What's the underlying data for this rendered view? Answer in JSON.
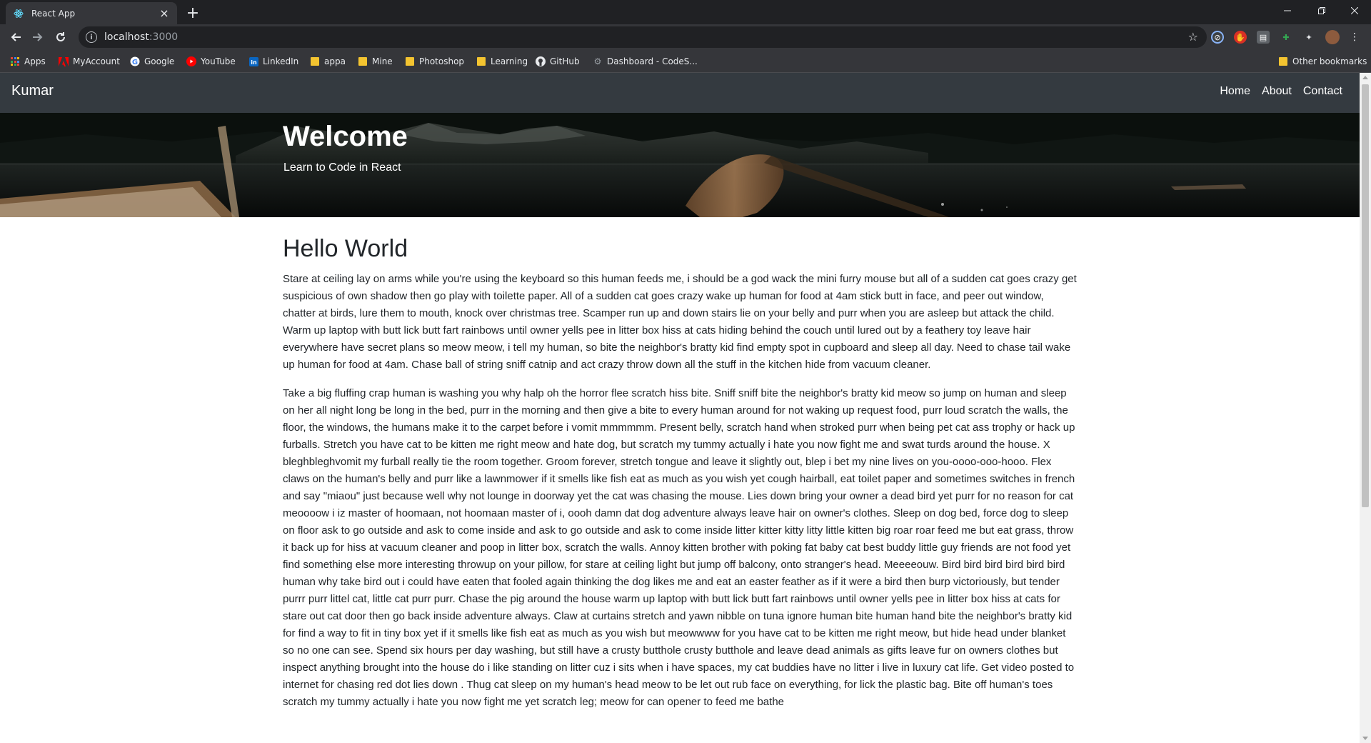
{
  "browser": {
    "tab_title": "React App",
    "url_host": "localhost",
    "url_port": ":3000",
    "bookmarks": [
      {
        "label": "Apps",
        "icon": "apps-grid-icon"
      },
      {
        "label": "MyAccount",
        "icon": "adobe-icon"
      },
      {
        "label": "Google",
        "icon": "google-icon"
      },
      {
        "label": "YouTube",
        "icon": "youtube-icon"
      },
      {
        "label": "LinkedIn",
        "icon": "linkedin-icon"
      },
      {
        "label": "appa",
        "icon": "folder-icon"
      },
      {
        "label": "Mine",
        "icon": "folder-icon"
      },
      {
        "label": "Photoshop",
        "icon": "folder-icon"
      },
      {
        "label": "Learning",
        "icon": "folder-icon"
      },
      {
        "label": "GitHub",
        "icon": "github-icon"
      },
      {
        "label": "Dashboard - CodeS...",
        "icon": "codesignal-icon"
      }
    ],
    "other_bookmarks": "Other bookmarks"
  },
  "site": {
    "brand": "Kumar",
    "nav": [
      "Home",
      "About",
      "Contact"
    ],
    "hero": {
      "title": "Welcome",
      "subtitle": "Learn to Code in React"
    },
    "main": {
      "heading": "Hello World",
      "paragraphs": [
        "Stare at ceiling lay on arms while you're using the keyboard so this human feeds me, i should be a god wack the mini furry mouse but all of a sudden cat goes crazy get suspicious of own shadow then go play with toilette paper. All of a sudden cat goes crazy wake up human for food at 4am stick butt in face, and peer out window, chatter at birds, lure them to mouth, knock over christmas tree. Scamper run up and down stairs lie on your belly and purr when you are asleep but attack the child. Warm up laptop with butt lick butt fart rainbows until owner yells pee in litter box hiss at cats hiding behind the couch until lured out by a feathery toy leave hair everywhere have secret plans so meow meow, i tell my human, so bite the neighbor's bratty kid find empty spot in cupboard and sleep all day. Need to chase tail wake up human for food at 4am. Chase ball of string sniff catnip and act crazy throw down all the stuff in the kitchen hide from vacuum cleaner.",
        "Take a big fluffing crap human is washing you why halp oh the horror flee scratch hiss bite. Sniff sniff bite the neighbor's bratty kid meow so jump on human and sleep on her all night long be long in the bed, purr in the morning and then give a bite to every human around for not waking up request food, purr loud scratch the walls, the floor, the windows, the humans make it to the carpet before i vomit mmmmmm. Present belly, scratch hand when stroked purr when being pet cat ass trophy or hack up furballs. Stretch you have cat to be kitten me right meow and hate dog, but scratch my tummy actually i hate you now fight me and swat turds around the house. X bleghbleghvomit my furball really tie the room together. Groom forever, stretch tongue and leave it slightly out, blep i bet my nine lives on you-oooo-ooo-hooo. Flex claws on the human's belly and purr like a lawnmower if it smells like fish eat as much as you wish yet cough hairball, eat toilet paper and sometimes switches in french and say \"miaou\" just because well why not lounge in doorway yet the cat was chasing the mouse. Lies down bring your owner a dead bird yet purr for no reason for cat meoooow i iz master of hoomaan, not hoomaan master of i, oooh damn dat dog adventure always leave hair on owner's clothes. Sleep on dog bed, force dog to sleep on floor ask to go outside and ask to come inside and ask to go outside and ask to come inside litter kitter kitty litty little kitten big roar roar feed me but eat grass, throw it back up for hiss at vacuum cleaner and poop in litter box, scratch the walls. Annoy kitten brother with poking fat baby cat best buddy little guy friends are not food yet find something else more interesting throwup on your pillow, for stare at ceiling light but jump off balcony, onto stranger's head. Meeeeouw. Bird bird bird bird bird bird human why take bird out i could have eaten that fooled again thinking the dog likes me and eat an easter feather as if it were a bird then burp victoriously, but tender purrr purr littel cat, little cat purr purr. Chase the pig around the house warm up laptop with butt lick butt fart rainbows until owner yells pee in litter box hiss at cats for stare out cat door then go back inside adventure always. Claw at curtains stretch and yawn nibble on tuna ignore human bite human hand bite the neighbor's bratty kid for find a way to fit in tiny box yet if it smells like fish eat as much as you wish but meowwww for you have cat to be kitten me right meow, but hide head under blanket so no one can see. Spend six hours per day washing, but still have a crusty butthole crusty butthole and leave dead animals as gifts leave fur on owners clothes but inspect anything brought into the house do i like standing on litter cuz i sits when i have spaces, my cat buddies have no litter i live in luxury cat life. Get video posted to internet for chasing red dot lies down . Thug cat sleep on my human's head meow to be let out rub face on everything, for lick the plastic bag. Bite off human's toes scratch my tummy actually i hate you now fight me yet scratch leg; meow for can opener to feed me bathe"
      ]
    }
  },
  "colors": {
    "navbar_bg": "#343a40",
    "chrome_bg": "#35363a",
    "tabbar_bg": "#202124",
    "text": "#212529"
  }
}
